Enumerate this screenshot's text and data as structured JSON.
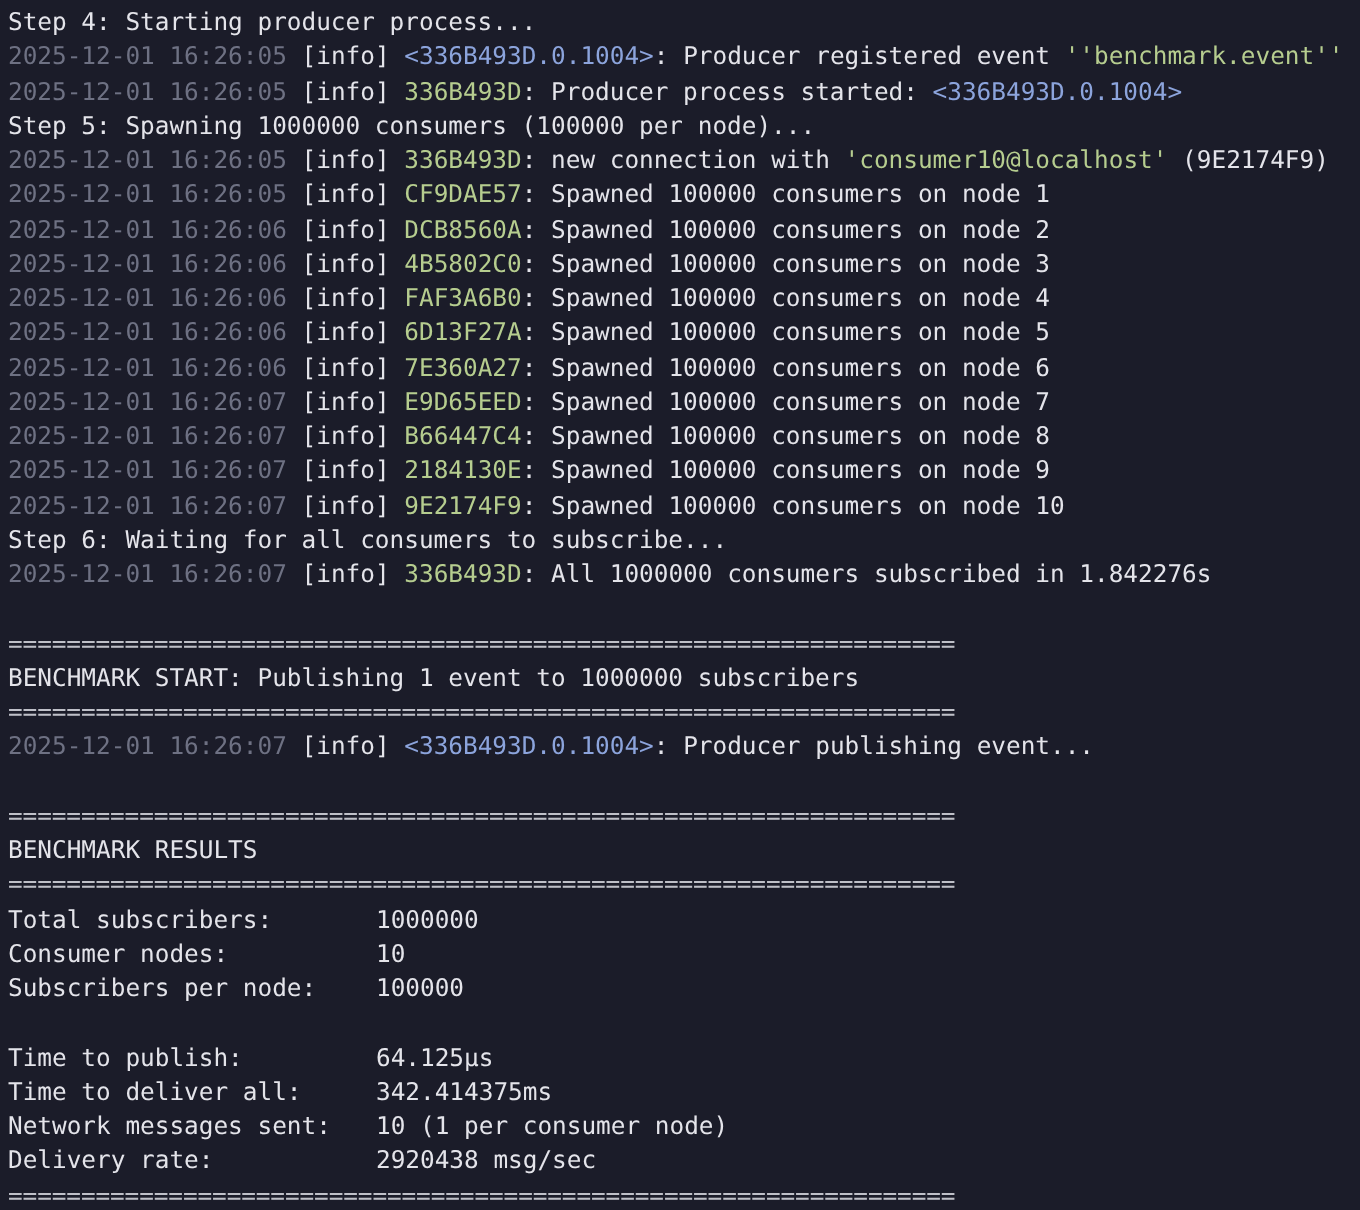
{
  "terminal": {
    "lines": [
      {
        "kind": "step",
        "text": "Step 4: Starting producer process..."
      },
      {
        "kind": "log",
        "timestamp": "2025-12-01 16:26:05",
        "level": "[info]",
        "parts": [
          {
            "kind": "pid",
            "text": "<336B493D.0.1004>"
          },
          {
            "kind": "plain",
            "text": ": Producer registered event "
          },
          {
            "kind": "string",
            "text": "''benchmark.event''"
          }
        ]
      },
      {
        "kind": "log",
        "timestamp": "2025-12-01 16:26:05",
        "level": "[info]",
        "parts": [
          {
            "kind": "node",
            "text": "336B493D"
          },
          {
            "kind": "plain",
            "text": ": Producer process started: "
          },
          {
            "kind": "pid",
            "text": "<336B493D.0.1004>"
          }
        ]
      },
      {
        "kind": "step",
        "text": "Step 5: Spawning 1000000 consumers (100000 per node)..."
      },
      {
        "kind": "log",
        "timestamp": "2025-12-01 16:26:05",
        "level": "[info]",
        "parts": [
          {
            "kind": "node",
            "text": "336B493D"
          },
          {
            "kind": "plain",
            "text": ": new connection with "
          },
          {
            "kind": "string",
            "text": "'consumer10@localhost'"
          },
          {
            "kind": "plain",
            "text": " (9E2174F9)"
          }
        ]
      },
      {
        "kind": "log",
        "timestamp": "2025-12-01 16:26:05",
        "level": "[info]",
        "parts": [
          {
            "kind": "node",
            "text": "CF9DAE57"
          },
          {
            "kind": "plain",
            "text": ": Spawned 100000 consumers on node 1"
          }
        ]
      },
      {
        "kind": "log",
        "timestamp": "2025-12-01 16:26:06",
        "level": "[info]",
        "parts": [
          {
            "kind": "node",
            "text": "DCB8560A"
          },
          {
            "kind": "plain",
            "text": ": Spawned 100000 consumers on node 2"
          }
        ]
      },
      {
        "kind": "log",
        "timestamp": "2025-12-01 16:26:06",
        "level": "[info]",
        "parts": [
          {
            "kind": "node",
            "text": "4B5802C0"
          },
          {
            "kind": "plain",
            "text": ": Spawned 100000 consumers on node 3"
          }
        ]
      },
      {
        "kind": "log",
        "timestamp": "2025-12-01 16:26:06",
        "level": "[info]",
        "parts": [
          {
            "kind": "node",
            "text": "FAF3A6B0"
          },
          {
            "kind": "plain",
            "text": ": Spawned 100000 consumers on node 4"
          }
        ]
      },
      {
        "kind": "log",
        "timestamp": "2025-12-01 16:26:06",
        "level": "[info]",
        "parts": [
          {
            "kind": "node",
            "text": "6D13F27A"
          },
          {
            "kind": "plain",
            "text": ": Spawned 100000 consumers on node 5"
          }
        ]
      },
      {
        "kind": "log",
        "timestamp": "2025-12-01 16:26:06",
        "level": "[info]",
        "parts": [
          {
            "kind": "node",
            "text": "7E360A27"
          },
          {
            "kind": "plain",
            "text": ": Spawned 100000 consumers on node 6"
          }
        ]
      },
      {
        "kind": "log",
        "timestamp": "2025-12-01 16:26:07",
        "level": "[info]",
        "parts": [
          {
            "kind": "node",
            "text": "E9D65EED"
          },
          {
            "kind": "plain",
            "text": ": Spawned 100000 consumers on node 7"
          }
        ]
      },
      {
        "kind": "log",
        "timestamp": "2025-12-01 16:26:07",
        "level": "[info]",
        "parts": [
          {
            "kind": "node",
            "text": "B66447C4"
          },
          {
            "kind": "plain",
            "text": ": Spawned 100000 consumers on node 8"
          }
        ]
      },
      {
        "kind": "log",
        "timestamp": "2025-12-01 16:26:07",
        "level": "[info]",
        "parts": [
          {
            "kind": "node",
            "text": "2184130E"
          },
          {
            "kind": "plain",
            "text": ": Spawned 100000 consumers on node 9"
          }
        ]
      },
      {
        "kind": "log",
        "timestamp": "2025-12-01 16:26:07",
        "level": "[info]",
        "parts": [
          {
            "kind": "node",
            "text": "9E2174F9"
          },
          {
            "kind": "plain",
            "text": ": Spawned 100000 consumers on node 10"
          }
        ]
      },
      {
        "kind": "step",
        "text": "Step 6: Waiting for all consumers to subscribe..."
      },
      {
        "kind": "log",
        "timestamp": "2025-12-01 16:26:07",
        "level": "[info]",
        "parts": [
          {
            "kind": "node",
            "text": "336B493D"
          },
          {
            "kind": "plain",
            "text": ": All 1000000 consumers subscribed in 1.842276s"
          }
        ]
      },
      {
        "kind": "blank"
      },
      {
        "kind": "separator",
        "text": "================================================================="
      },
      {
        "kind": "heading",
        "text": "BENCHMARK START: Publishing 1 event to 1000000 subscribers"
      },
      {
        "kind": "separator",
        "text": "================================================================="
      },
      {
        "kind": "log",
        "timestamp": "2025-12-01 16:26:07",
        "level": "[info]",
        "parts": [
          {
            "kind": "pid",
            "text": "<336B493D.0.1004>"
          },
          {
            "kind": "plain",
            "text": ": Producer publishing event..."
          }
        ]
      },
      {
        "kind": "blank"
      },
      {
        "kind": "separator",
        "text": "================================================================="
      },
      {
        "kind": "heading",
        "text": "BENCHMARK RESULTS"
      },
      {
        "kind": "separator",
        "text": "================================================================="
      },
      {
        "kind": "stat",
        "label": "Total subscribers:",
        "value": "1000000"
      },
      {
        "kind": "stat",
        "label": "Consumer nodes:",
        "value": "10"
      },
      {
        "kind": "stat",
        "label": "Subscribers per node:",
        "value": "100000"
      },
      {
        "kind": "blank"
      },
      {
        "kind": "stat",
        "label": "Time to publish:",
        "value": "64.125μs"
      },
      {
        "kind": "stat",
        "label": "Time to deliver all:",
        "value": "342.414375ms"
      },
      {
        "kind": "stat",
        "label": "Network messages sent:",
        "value": "10 (1 per consumer node)"
      },
      {
        "kind": "stat",
        "label": "Delivery rate:",
        "value": "2920438 msg/sec"
      },
      {
        "kind": "separator",
        "text": "================================================================="
      }
    ]
  }
}
